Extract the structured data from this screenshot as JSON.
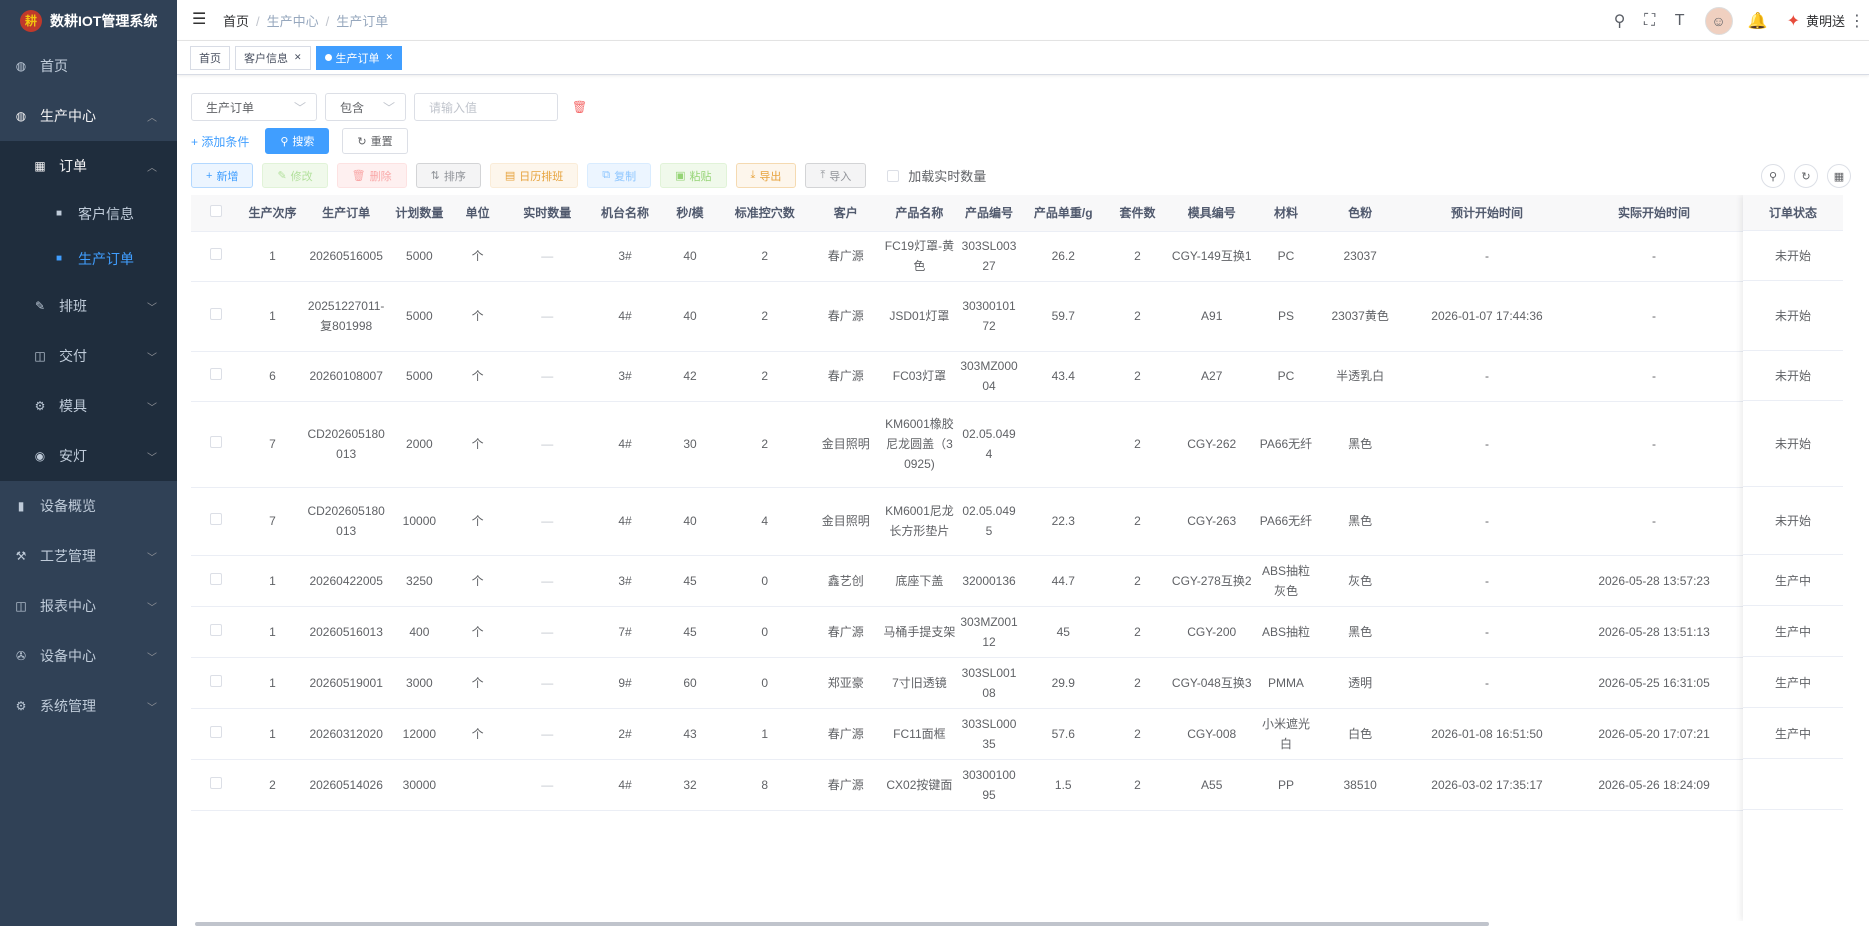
{
  "app": {
    "title": "数耕IOT管理系统",
    "logo_char": "耕"
  },
  "sidebar": {
    "items": [
      {
        "label": "首页",
        "icon": "dashboard-icon"
      },
      {
        "label": "生产中心",
        "icon": "dashboard-icon"
      },
      {
        "label": "订单",
        "icon": "grid-icon"
      },
      {
        "label": "客户信息",
        "icon": "squares-icon"
      },
      {
        "label": "生产订单",
        "icon": "squares-icon"
      },
      {
        "label": "排班",
        "icon": "edit-icon"
      },
      {
        "label": "交付",
        "icon": "book-icon"
      },
      {
        "label": "模具",
        "icon": "gear-icon"
      },
      {
        "label": "安灯",
        "icon": "radio-icon"
      },
      {
        "label": "设备概览",
        "icon": "chart-icon"
      },
      {
        "label": "工艺管理",
        "icon": "process-icon"
      },
      {
        "label": "报表中心",
        "icon": "book-icon"
      },
      {
        "label": "设备中心",
        "icon": "device-icon"
      },
      {
        "label": "系统管理",
        "icon": "gear-icon"
      }
    ]
  },
  "navbar": {
    "breadcrumb": [
      "首页",
      "生产中心",
      "生产订单"
    ],
    "user_name": "黄明送"
  },
  "tags": [
    {
      "label": "首页"
    },
    {
      "label": "客户信息"
    },
    {
      "label": "生产订单"
    }
  ],
  "filter": {
    "field": "生产订单",
    "operator": "包含",
    "placeholder": "请输入值",
    "add_condition": "+ 添加条件",
    "search": "搜索",
    "reset": "重置"
  },
  "toolbar": {
    "add": "新增",
    "edit": "修改",
    "delete": "删除",
    "sort": "排序",
    "calendar": "日历排班",
    "copy": "复制",
    "paste": "粘贴",
    "export": "导出",
    "import": "导入",
    "realtime_checkbox": "加载实时数量"
  },
  "table": {
    "columns": [
      "生产次序",
      "生产订单",
      "计划数量",
      "单位",
      "实时数量",
      "机台名称",
      "秒/模",
      "标准控穴数",
      "客户",
      "产品名称",
      "产品编号",
      "产品单重/g",
      "套件数",
      "模具编号",
      "材料",
      "色粉",
      "预计开始时间",
      "实际开始时间"
    ],
    "status_header": "订单状态",
    "rows": [
      {
        "cells": [
          "1",
          "20260516005",
          "5000",
          "个",
          "—",
          "3#",
          "40",
          "2",
          "春广源",
          "FC19灯罩-黄色",
          "303SL00327",
          "26.2",
          "2",
          "CGY-149互换1",
          "PC",
          "23037",
          "-",
          "-"
        ],
        "status": "未开始"
      },
      {
        "cells": [
          "1",
          "20251227011-复801998",
          "5000",
          "个",
          "—",
          "4#",
          "40",
          "2",
          "春广源",
          "JSD01灯罩",
          "3030010172",
          "59.7",
          "2",
          "A91",
          "PS",
          "23037黄色",
          "2026-01-07 17:44:36",
          "-"
        ],
        "status": "未开始"
      },
      {
        "cells": [
          "6",
          "20260108007",
          "5000",
          "个",
          "—",
          "3#",
          "42",
          "2",
          "春广源",
          "FC03灯罩",
          "303MZ00004",
          "43.4",
          "2",
          "A27",
          "PC",
          "半透乳白",
          "-",
          "-"
        ],
        "status": "未开始"
      },
      {
        "cells": [
          "7",
          "CD202605180013",
          "2000",
          "个",
          "—",
          "4#",
          "30",
          "2",
          "金目照明",
          "KM6001橡胶尼龙圆盖（30925)",
          "02.05.0494",
          "",
          "2",
          "CGY-262",
          "PA66无纤",
          "黑色",
          "-",
          "-"
        ],
        "status": "未开始"
      },
      {
        "cells": [
          "7",
          "CD202605180013",
          "10000",
          "个",
          "—",
          "4#",
          "40",
          "4",
          "金目照明",
          "KM6001尼龙长方形垫片",
          "02.05.0495",
          "22.3",
          "2",
          "CGY-263",
          "PA66无纤",
          "黑色",
          "-",
          "-"
        ],
        "status": "未开始"
      },
      {
        "cells": [
          "1",
          "20260422005",
          "3250",
          "个",
          "—",
          "3#",
          "45",
          "0",
          "鑫艺创",
          "底座下盖",
          "32000136",
          "44.7",
          "2",
          "CGY-278互换2",
          "ABS抽粒灰色",
          "灰色",
          "-",
          "2026-05-28 13:57:23"
        ],
        "status": "生产中"
      },
      {
        "cells": [
          "1",
          "20260516013",
          "400",
          "个",
          "—",
          "7#",
          "45",
          "0",
          "春广源",
          "马桶手提支架",
          "303MZ00112",
          "45",
          "2",
          "CGY-200",
          "ABS抽粒",
          "黑色",
          "-",
          "2026-05-28 13:51:13"
        ],
        "status": "生产中"
      },
      {
        "cells": [
          "1",
          "20260519001",
          "3000",
          "个",
          "—",
          "9#",
          "60",
          "0",
          "郑亚豪",
          "7寸旧透镜",
          "303SL00108",
          "29.9",
          "2",
          "CGY-048互换3",
          "PMMA",
          "透明",
          "-",
          "2026-05-25 16:31:05"
        ],
        "status": "生产中"
      },
      {
        "cells": [
          "1",
          "20260312020",
          "12000",
          "个",
          "—",
          "2#",
          "43",
          "1",
          "春广源",
          "FC11面框",
          "303SL00035",
          "57.6",
          "2",
          "CGY-008",
          "小米遮光白",
          "白色",
          "2026-01-08 16:51:50",
          "2026-05-20 17:07:21"
        ],
        "status": "生产中"
      },
      {
        "cells": [
          "2",
          "20260514026",
          "30000",
          "",
          "—",
          "4#",
          "32",
          "8",
          "春广源",
          "CX02按键面",
          "3030010095",
          "1.5",
          "2",
          "A55",
          "PP",
          "38510",
          "2026-03-02 17:35:17",
          "2026-05-26 18:24:09"
        ],
        "status": ""
      }
    ]
  }
}
